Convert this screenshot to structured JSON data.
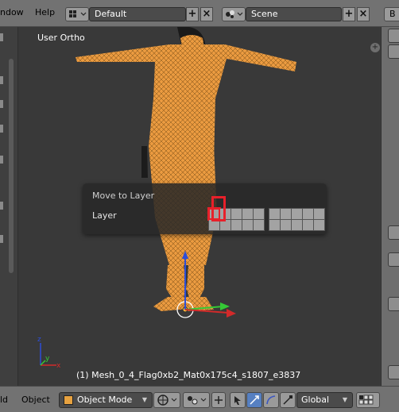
{
  "topbar": {
    "menu_window": "ndow",
    "menu_help": "Help",
    "screen_layout": "Default",
    "scene": "Scene",
    "right_cut": "B"
  },
  "viewport": {
    "view_label": "User Ortho",
    "status": "(1) Mesh_0_4_Flag0xb2_Mat0x175c4_s1807_e3837"
  },
  "popup": {
    "title": "Move to Layer",
    "label": "Layer",
    "active_layer": 1
  },
  "bottombar": {
    "menu_add": "ld",
    "menu_object": "Object",
    "mode": "Object Mode",
    "transform_orientation": "Global"
  },
  "colors": {
    "mesh_wire": "#f4a244",
    "highlight": "#e8202a",
    "background": "#393939"
  }
}
